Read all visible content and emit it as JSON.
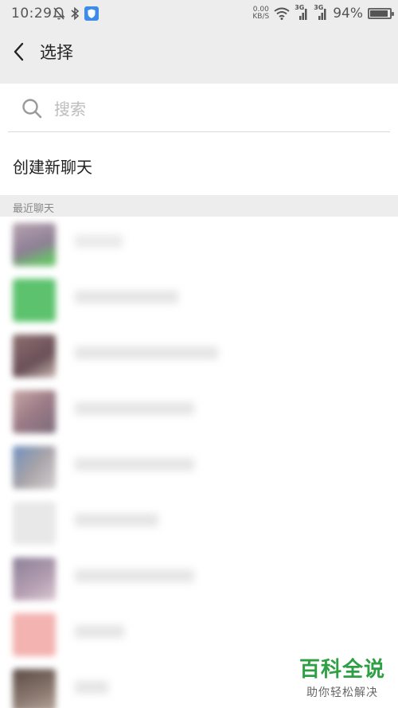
{
  "status_bar": {
    "time": "10:29",
    "net_speed_value": "0.00",
    "net_speed_unit": "KB/S",
    "signal_1_label": "3G",
    "signal_2_label": "3G",
    "battery_text": "94%",
    "battery_level": 0.94
  },
  "header": {
    "title": "选择"
  },
  "search": {
    "placeholder": "搜索"
  },
  "new_chat": {
    "label": "创建新聊天"
  },
  "section": {
    "recent_label": "最近聊天"
  },
  "colors": {
    "accent_green": "#2ea043",
    "list_background": "#ffffff",
    "page_background": "#ededed"
  },
  "watermark": {
    "title": "百科全说",
    "subtitle": "助你轻松解决"
  }
}
